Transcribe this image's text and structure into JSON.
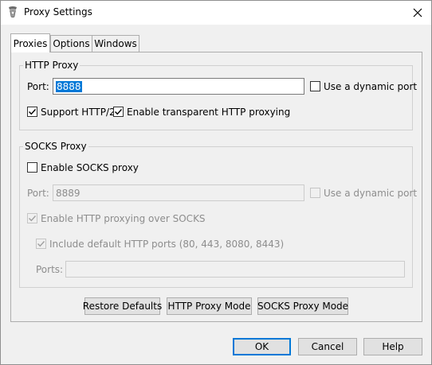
{
  "window": {
    "title": "Proxy Settings"
  },
  "tabs": [
    {
      "label": "Proxies",
      "active": true
    },
    {
      "label": "Options",
      "active": false
    },
    {
      "label": "Windows",
      "active": false
    }
  ],
  "http_proxy": {
    "group_title": "HTTP Proxy",
    "port_label": "Port:",
    "port_value": "8888",
    "dynamic_port_label": "Use a dynamic port",
    "dynamic_port_checked": false,
    "http2_label": "Support HTTP/2",
    "http2_checked": true,
    "transparent_label": "Enable transparent HTTP proxying",
    "transparent_checked": true
  },
  "socks_proxy": {
    "group_title": "SOCKS Proxy",
    "enable_label": "Enable SOCKS proxy",
    "enable_checked": false,
    "port_label": "Port:",
    "port_value": "8889",
    "dynamic_port_label": "Use a dynamic port",
    "http_over_socks_label": "Enable HTTP proxying over SOCKS",
    "http_over_socks_checked": true,
    "default_ports_label": "Include default HTTP ports (80, 443, 8080, 8443)",
    "default_ports_checked": true,
    "ports_label": "Ports:",
    "ports_value": ""
  },
  "panel_buttons": {
    "restore_defaults": "Restore Defaults",
    "http_mode": "HTTP Proxy Mode",
    "socks_mode": "SOCKS Proxy Mode"
  },
  "dialog_buttons": {
    "ok": "OK",
    "cancel": "Cancel",
    "help": "Help"
  },
  "colors": {
    "accent": "#0078d7",
    "window_bg": "#f0f0f0",
    "disabled_text": "#8d8d8d"
  }
}
